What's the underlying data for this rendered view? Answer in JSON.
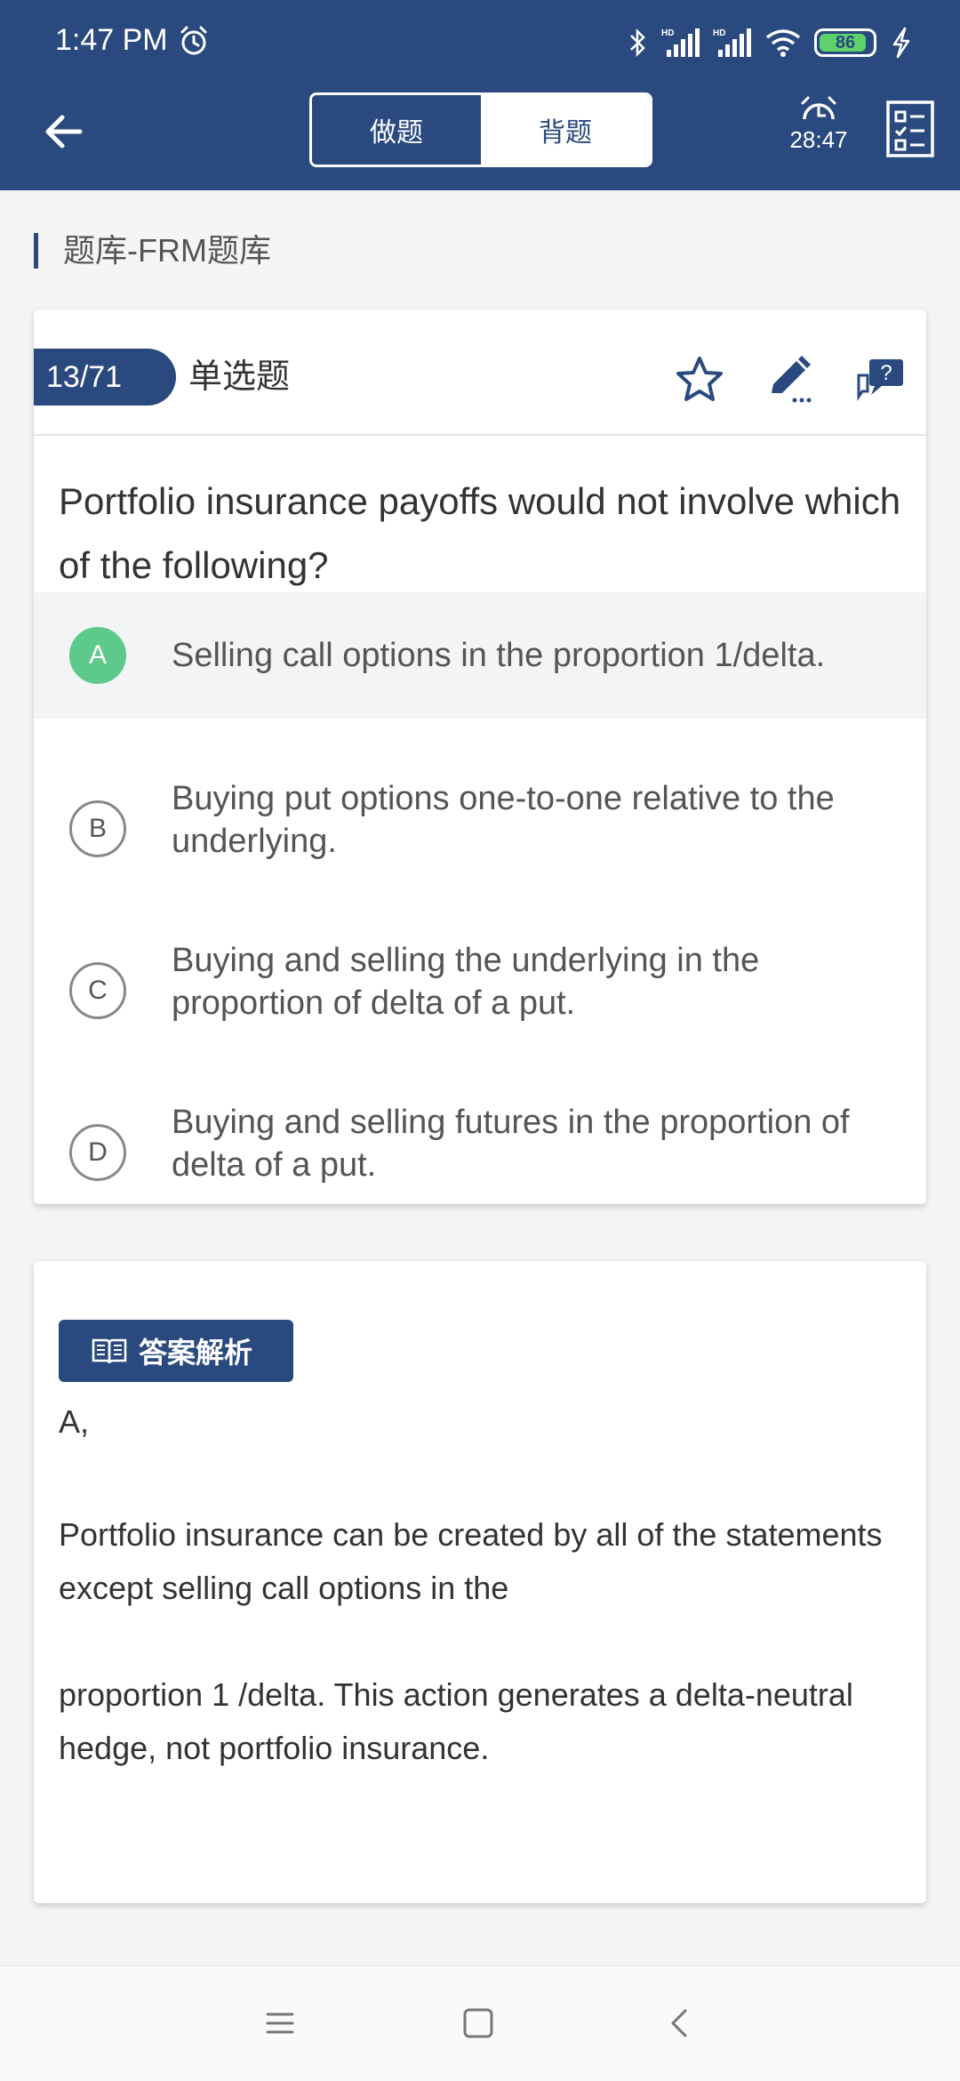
{
  "status_bar": {
    "time": "1:47 PM",
    "battery": "86"
  },
  "toolbar": {
    "mode_tabs": [
      "做题",
      "背题"
    ],
    "active_tab": 0,
    "timer": "28:47"
  },
  "breadcrumb": "题库-FRM题库",
  "question": {
    "number": "13/71",
    "type": "单选题",
    "stem": "Portfolio insurance payoffs would not involve which of the following?",
    "options": [
      {
        "letter": "A",
        "text": "Selling call options in the proportion 1/delta.",
        "correct": true
      },
      {
        "letter": "B",
        "text": "Buying put options one-to-one relative to the underlying."
      },
      {
        "letter": "C",
        "text": "Buying and selling the underlying in the proportion of delta of a put."
      },
      {
        "letter": "D",
        "text": "Buying and selling futures in the proportion of delta of a put."
      }
    ]
  },
  "explanation": {
    "badge": "答案解析",
    "answer": "A,",
    "paragraphs": [
      "Portfolio insurance can be created by all of the statements except selling call options in the",
      "proportion 1 /delta. This action generates a delta-neutral hedge, not portfolio insurance."
    ]
  },
  "colors": {
    "primary": "#2a4a7f",
    "correct": "#5dc98a",
    "battery": "#5fd06b"
  },
  "icons": [
    "alarm-icon",
    "bluetooth-icon",
    "signal-icon",
    "wifi-icon",
    "battery-icon",
    "charging-icon",
    "back-arrow-icon",
    "timer-icon",
    "answer-sheet-icon",
    "star-icon",
    "pencil-icon",
    "question-feedback-icon",
    "book-icon",
    "menu-icon",
    "home-icon",
    "back-nav-icon"
  ]
}
